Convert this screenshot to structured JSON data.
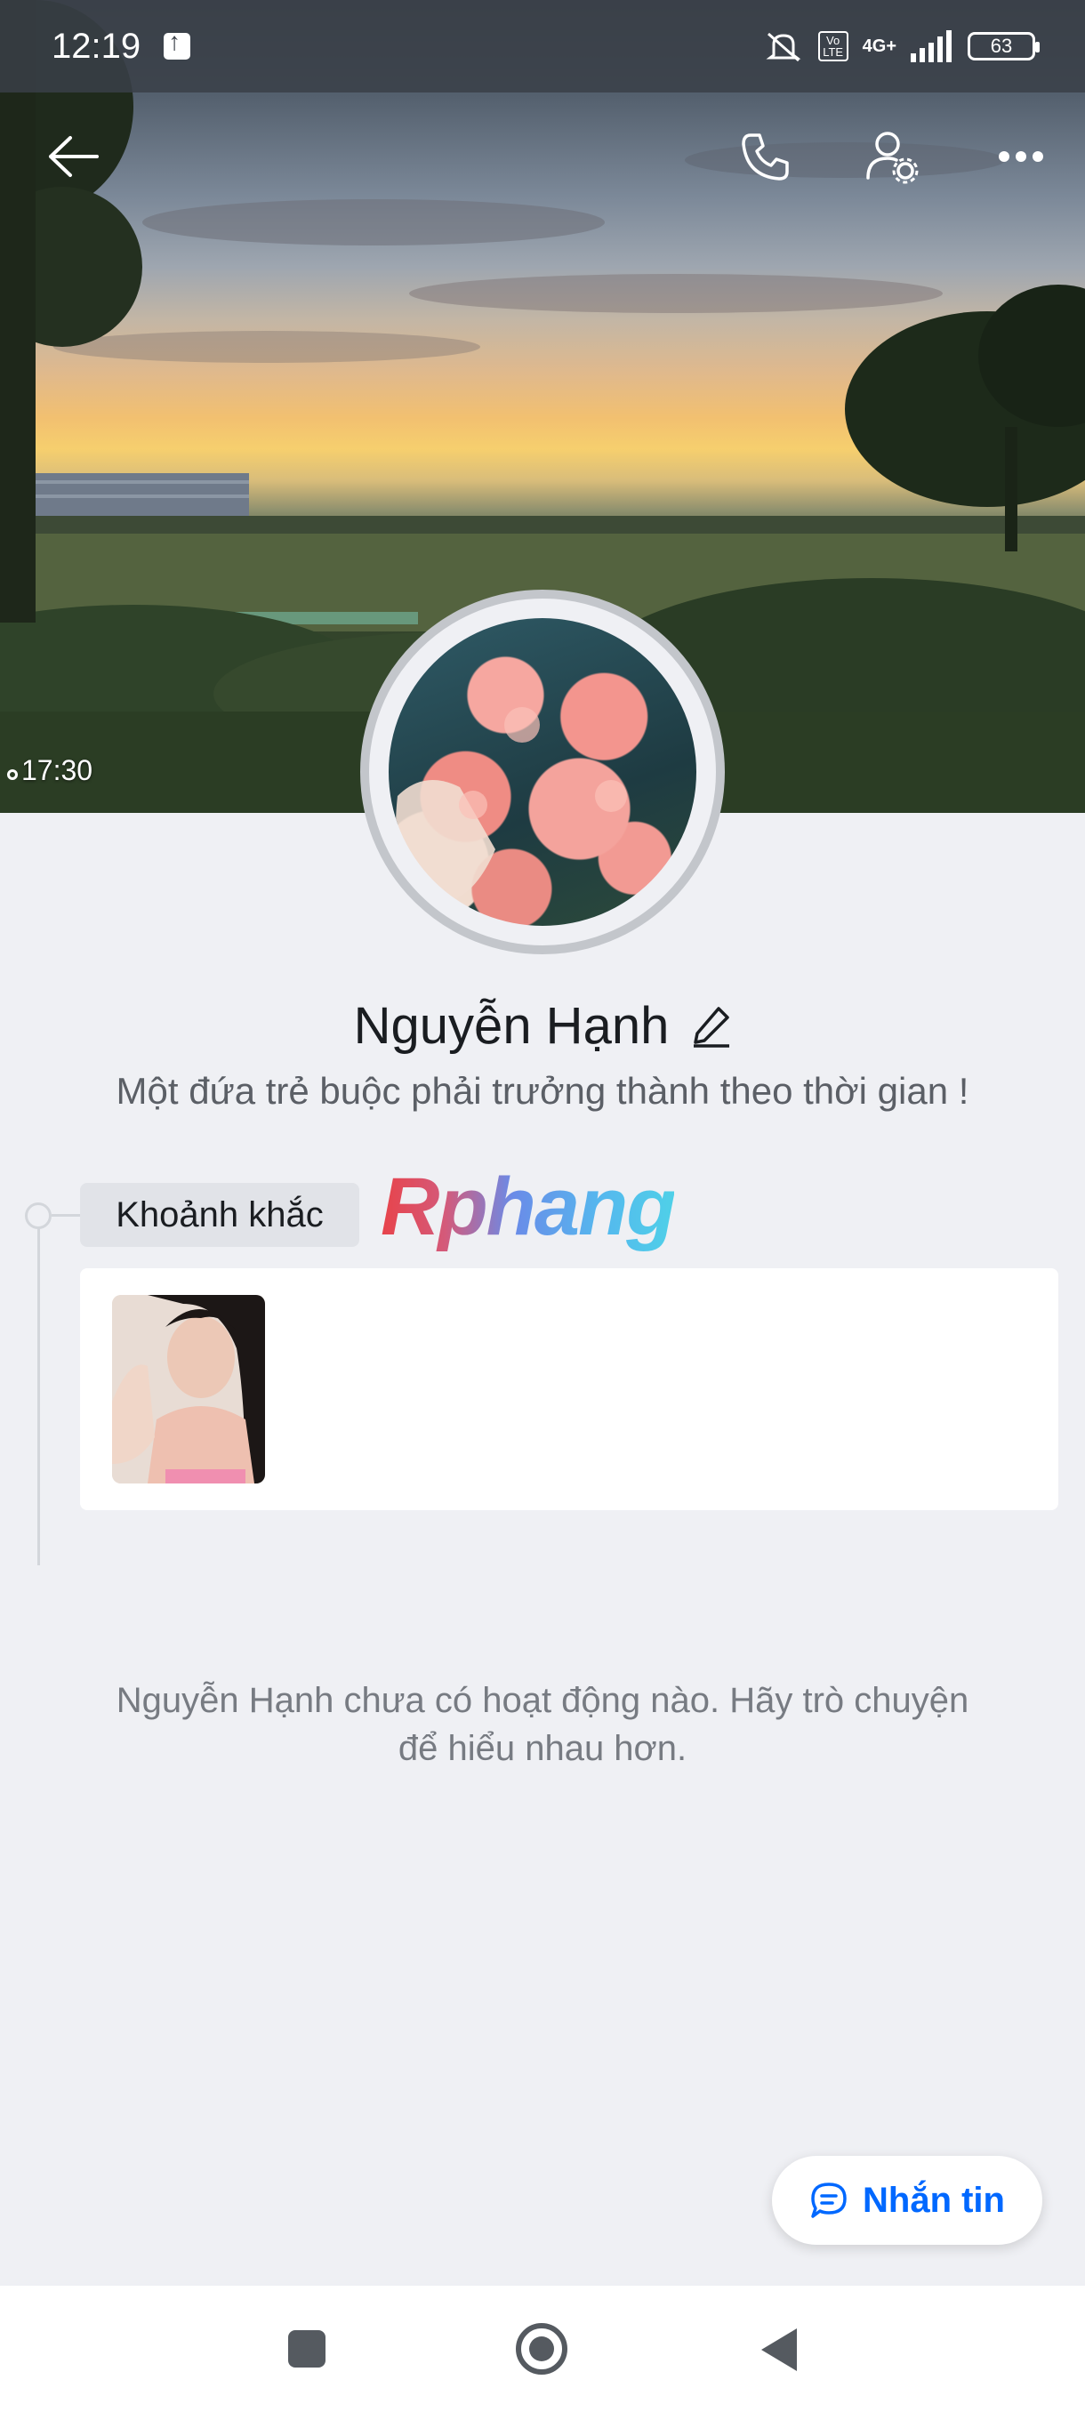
{
  "status_bar": {
    "time": "12:19",
    "network_badge": "4G+",
    "volte_badge": "Vo LTE",
    "battery": "63",
    "icons": [
      "upload-notification-icon",
      "mute-icon",
      "signal-icon",
      "battery-icon"
    ]
  },
  "header": {
    "icons": [
      "back-arrow-icon",
      "phone-icon",
      "user-settings-icon",
      "more-icon"
    ]
  },
  "cover": {
    "timestamp": "17:30"
  },
  "profile": {
    "name": "Nguyễn Hạnh",
    "bio": "Một đứa trẻ buộc phải trưởng thành theo thời gian !",
    "edit_icon": "pencil-icon"
  },
  "moments": {
    "label": "Khoảnh khắc",
    "watermark": "Rphang"
  },
  "activity": {
    "empty_message": "Nguyễn Hạnh chưa có hoạt động nào. Hãy trò chuyện để hiểu nhau hơn."
  },
  "message_button": {
    "label": "Nhắn tin",
    "icon": "chat-bubble-icon",
    "color": "#0068ff"
  },
  "system_nav": {
    "icons": [
      "recents-square-icon",
      "home-circle-icon",
      "back-triangle-icon"
    ]
  }
}
